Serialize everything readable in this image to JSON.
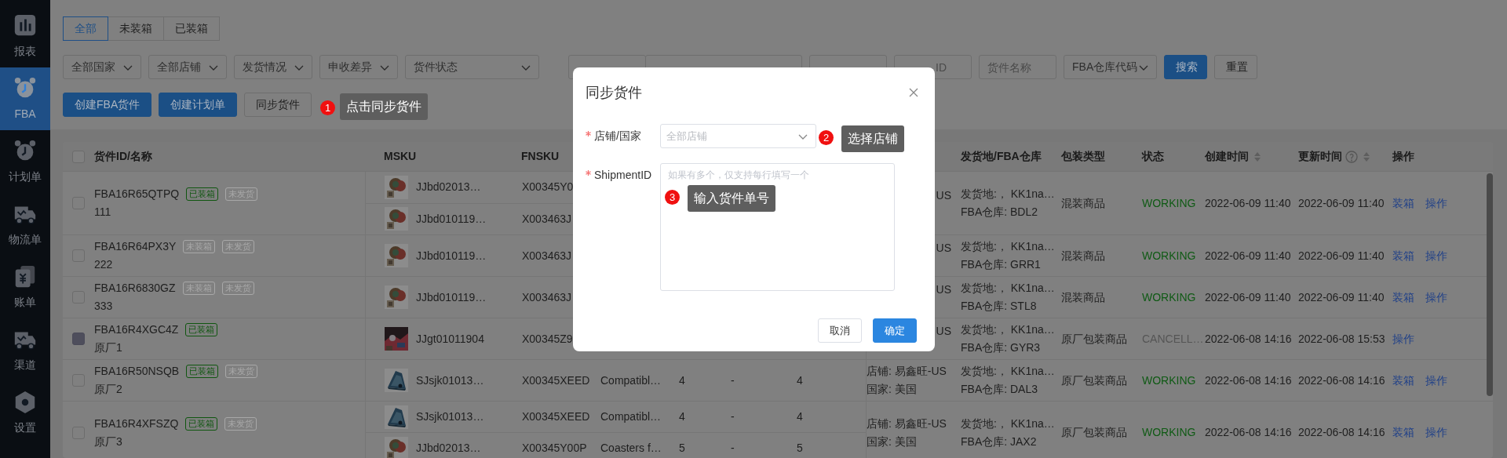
{
  "sidebar": {
    "items": [
      {
        "label": "报表",
        "selected": false
      },
      {
        "label": "FBA",
        "selected": true
      },
      {
        "label": "计划单",
        "selected": false
      },
      {
        "label": "物流单",
        "selected": false
      },
      {
        "label": "账单",
        "selected": false
      },
      {
        "label": "渠道",
        "selected": false
      },
      {
        "label": "设置",
        "selected": false
      }
    ]
  },
  "tabs": [
    {
      "label": "全部",
      "selected": true
    },
    {
      "label": "未装箱",
      "selected": false
    },
    {
      "label": "已装箱",
      "selected": false
    }
  ],
  "filters": [
    {
      "kind": "select",
      "text": "全部国家"
    },
    {
      "kind": "select",
      "text": "全部店铺"
    },
    {
      "kind": "select",
      "text": "发货情况"
    },
    {
      "kind": "select",
      "text": "申收差异"
    },
    {
      "kind": "select",
      "text": "货件状态"
    },
    {
      "kind": "select"
    },
    {
      "kind": "date_range"
    },
    {
      "kind": "input"
    },
    {
      "kind": "input",
      "placeholder": "ID"
    },
    {
      "kind": "input",
      "placeholder": "货件名称"
    },
    {
      "kind": "select",
      "text": "FBA仓库代码"
    },
    {
      "kind": "button",
      "text": "搜索",
      "primary": true
    },
    {
      "kind": "button",
      "text": "重置",
      "primary": false
    }
  ],
  "actions": [
    {
      "label": "创建FBA货件",
      "primary": true
    },
    {
      "label": "创建计划单",
      "primary": true
    },
    {
      "label": "同步货件",
      "primary": false
    }
  ],
  "table": {
    "select_all": {
      "checked": false
    },
    "columns": [
      {
        "kind": "id",
        "label": "货件ID/名称"
      },
      {
        "kind": "msku",
        "label": "MSKU"
      },
      {
        "kind": "fnsku",
        "label": "FNSKU"
      },
      {
        "kind": "origin",
        "label": "发货地/FBA仓库"
      },
      {
        "kind": "pack",
        "label": "包装类型"
      },
      {
        "kind": "status",
        "label": "状态"
      },
      {
        "kind": "created",
        "label": "创建时间",
        "sortable": true
      },
      {
        "kind": "updated",
        "label": "更新时间",
        "help": true,
        "sortable": true
      },
      {
        "kind": "ops",
        "label": "操作"
      }
    ],
    "rows": [
      {
        "checked": false,
        "disabled": false,
        "id": "FBA16R65QTPQ",
        "tags": [
          {
            "text": "已装箱",
            "color": "#0f560f"
          },
          {
            "text": "未发货",
            "color": "#a8a8a8"
          }
        ],
        "name": "111",
        "items": [
          {
            "msku": "JJbd02013…",
            "fnsku": "X00345Y0"
          },
          {
            "msku": "JJbd010119…",
            "fnsku": "X003463J"
          }
        ],
        "store": "US",
        "origin": "发货地:， KK1na…",
        "warehouse": "FBA仓库: BDL2",
        "pack": "混装商品",
        "status": {
          "text": "WORKING",
          "color": "#0f5a14"
        },
        "created": "2022-06-09 11:40",
        "updated": "2022-06-09 11:40",
        "ops": [
          "装箱",
          "操作"
        ]
      },
      {
        "checked": false,
        "disabled": false,
        "id": "FBA16R64PX3Y",
        "tags": [
          {
            "text": "未装箱",
            "color": "#a8a8a8"
          },
          {
            "text": "未发货",
            "color": "#a8a8a8"
          }
        ],
        "name": "222",
        "items": [
          {
            "msku": "JJbd010119…",
            "fnsku": "X003463J"
          }
        ],
        "store": "US",
        "origin": "发货地:， KK1na…",
        "warehouse": "FBA仓库: GRR1",
        "pack": "混装商品",
        "status": {
          "text": "WORKING",
          "color": "#0f5a14"
        },
        "created": "2022-06-09 11:40",
        "updated": "2022-06-09 11:40",
        "ops": [
          "装箱",
          "操作"
        ]
      },
      {
        "checked": false,
        "disabled": false,
        "id": "FBA16R6830GZ",
        "tags": [
          {
            "text": "未装箱",
            "color": "#a8a8a8"
          },
          {
            "text": "未发货",
            "color": "#a8a8a8"
          }
        ],
        "name": "333",
        "items": [
          {
            "msku": "JJbd010119…",
            "fnsku": "X003463J"
          }
        ],
        "store": "US",
        "origin": "发货地:， KK1na…",
        "warehouse": "FBA仓库: STL8",
        "pack": "混装商品",
        "status": {
          "text": "WORKING",
          "color": "#0f5a14"
        },
        "created": "2022-06-09 11:40",
        "updated": "2022-06-09 11:40",
        "ops": [
          "装箱",
          "操作"
        ]
      },
      {
        "checked": false,
        "disabled": true,
        "id": "FBA16R4XGC4Z",
        "tags": [
          {
            "text": "已装箱",
            "color": "#0f560f"
          }
        ],
        "name": "原厂1",
        "items": [
          {
            "msku": "JJgt01011904",
            "fnsku": "X00345Z9"
          }
        ],
        "store": "US",
        "origin": "发货地:， KK1na…",
        "warehouse": "FBA仓库: GYR3",
        "pack": "原厂包装商品",
        "status": {
          "text": "CANCELL…",
          "color": "#555555"
        },
        "created": "2022-06-08 14:16",
        "updated": "2022-06-08 15:53",
        "ops": [
          "操作"
        ]
      },
      {
        "checked": false,
        "disabled": false,
        "id": "FBA16R50NSQB",
        "tags": [
          {
            "text": "已装箱",
            "color": "#0f560f"
          },
          {
            "text": "未发货",
            "color": "#a8a8a8"
          }
        ],
        "name": "原厂2",
        "items": [
          {
            "msku": "SJsjk01013…",
            "fnsku": "X00345XEED",
            "product": "Compatibl…",
            "qty_1": "4",
            "qty_2": "-",
            "qty_3": "4"
          }
        ],
        "store": "店铺: 易鑫旺-US",
        "country": "国家: 美国",
        "origin": "发货地:， KK1na…",
        "warehouse": "FBA仓库: DAL3",
        "pack": "原厂包装商品",
        "status": {
          "text": "WORKING",
          "color": "#0f5a14"
        },
        "created": "2022-06-08 14:16",
        "updated": "2022-06-08 14:16",
        "ops": [
          "装箱",
          "操作"
        ]
      },
      {
        "checked": false,
        "disabled": false,
        "id": "FBA16R4XFSZQ",
        "tags": [
          {
            "text": "已装箱",
            "color": "#0f560f"
          },
          {
            "text": "未发货",
            "color": "#a8a8a8"
          }
        ],
        "name": "原厂3",
        "items": [
          {
            "msku": "SJsjk01013…",
            "fnsku": "X00345XEED",
            "product": "Compatibl…",
            "qty_1": "4",
            "qty_2": "-",
            "qty_3": "4"
          },
          {
            "msku": "JJbd02013…",
            "fnsku": "X00345Y00P",
            "product": "Coasters f…",
            "qty_1": "5",
            "qty_2": "-",
            "qty_3": "5"
          }
        ],
        "store": "店铺: 易鑫旺-US",
        "country": "国家: 美国",
        "origin": "发货地:， KK1na…",
        "warehouse": "FBA仓库: JAX2",
        "pack": "原厂包装商品",
        "status": {
          "text": "WORKING",
          "color": "#0f5a14"
        },
        "created": "2022-06-08 14:16",
        "updated": "2022-06-08 14:16",
        "ops": [
          "装箱",
          "操作"
        ]
      }
    ]
  },
  "dialog": {
    "title": "同步货件",
    "fields": [
      {
        "kind": "select",
        "label": "店铺/国家",
        "required": true,
        "placeholder": "全部店铺"
      },
      {
        "kind": "textarea",
        "label": "ShipmentID",
        "required": true,
        "placeholder": "如果有多个，仅支持每行填写一个"
      }
    ],
    "buttons": [
      {
        "label": "取消",
        "primary": false
      },
      {
        "label": "确定",
        "primary": true
      }
    ]
  },
  "callouts": [
    {
      "number": "1",
      "text": "点击同步货件"
    },
    {
      "number": "2",
      "text": "选择店铺"
    },
    {
      "number": "3",
      "text": "输入货件单号"
    }
  ]
}
